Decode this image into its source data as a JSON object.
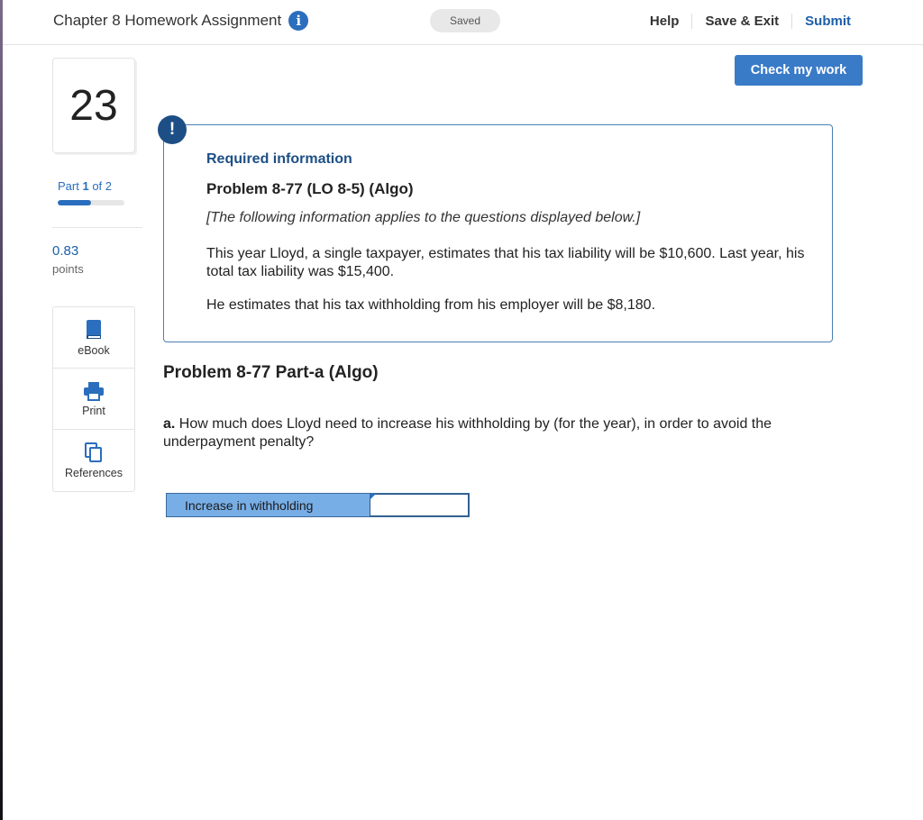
{
  "header": {
    "title": "Chapter 8 Homework Assignment",
    "status": "Saved",
    "help_label": "Help",
    "save_exit_label": "Save & Exit",
    "submit_label": "Submit"
  },
  "sidebar": {
    "question_number": "23",
    "part_prefix": "Part",
    "part_current": "1",
    "part_of": "of 2",
    "part_progress_fraction": 0.5,
    "points_value": "0.83",
    "points_label": "points",
    "tools": [
      {
        "label": "eBook",
        "icon": "book-icon"
      },
      {
        "label": "Print",
        "icon": "printer-icon"
      },
      {
        "label": "References",
        "icon": "copy-icon"
      }
    ]
  },
  "main": {
    "check_label": "Check my work",
    "required_heading": "Required information",
    "problem_title": "Problem 8-77 (LO 8-5) (Algo)",
    "problem_note": "[The following information applies to the questions displayed below.]",
    "problem_text_1": "This year Lloyd, a single taxpayer, estimates that his tax liability will be $10,600. Last year, his total tax liability was $15,400.",
    "problem_text_2": "He estimates that his tax withholding from his employer will be $8,180.",
    "part_title": "Problem 8-77 Part-a (Algo)",
    "question_letter": "a.",
    "question_text": "How much does Lloyd need to increase his withholding by (for the year), in order to avoid the underpayment penalty?",
    "answer_label": "Increase in withholding",
    "answer_value": ""
  },
  "colors": {
    "accent": "#2a6ebd",
    "button": "#3a7bc8",
    "heading_blue": "#1d4f86",
    "answer_label_bg": "#78aee6"
  }
}
